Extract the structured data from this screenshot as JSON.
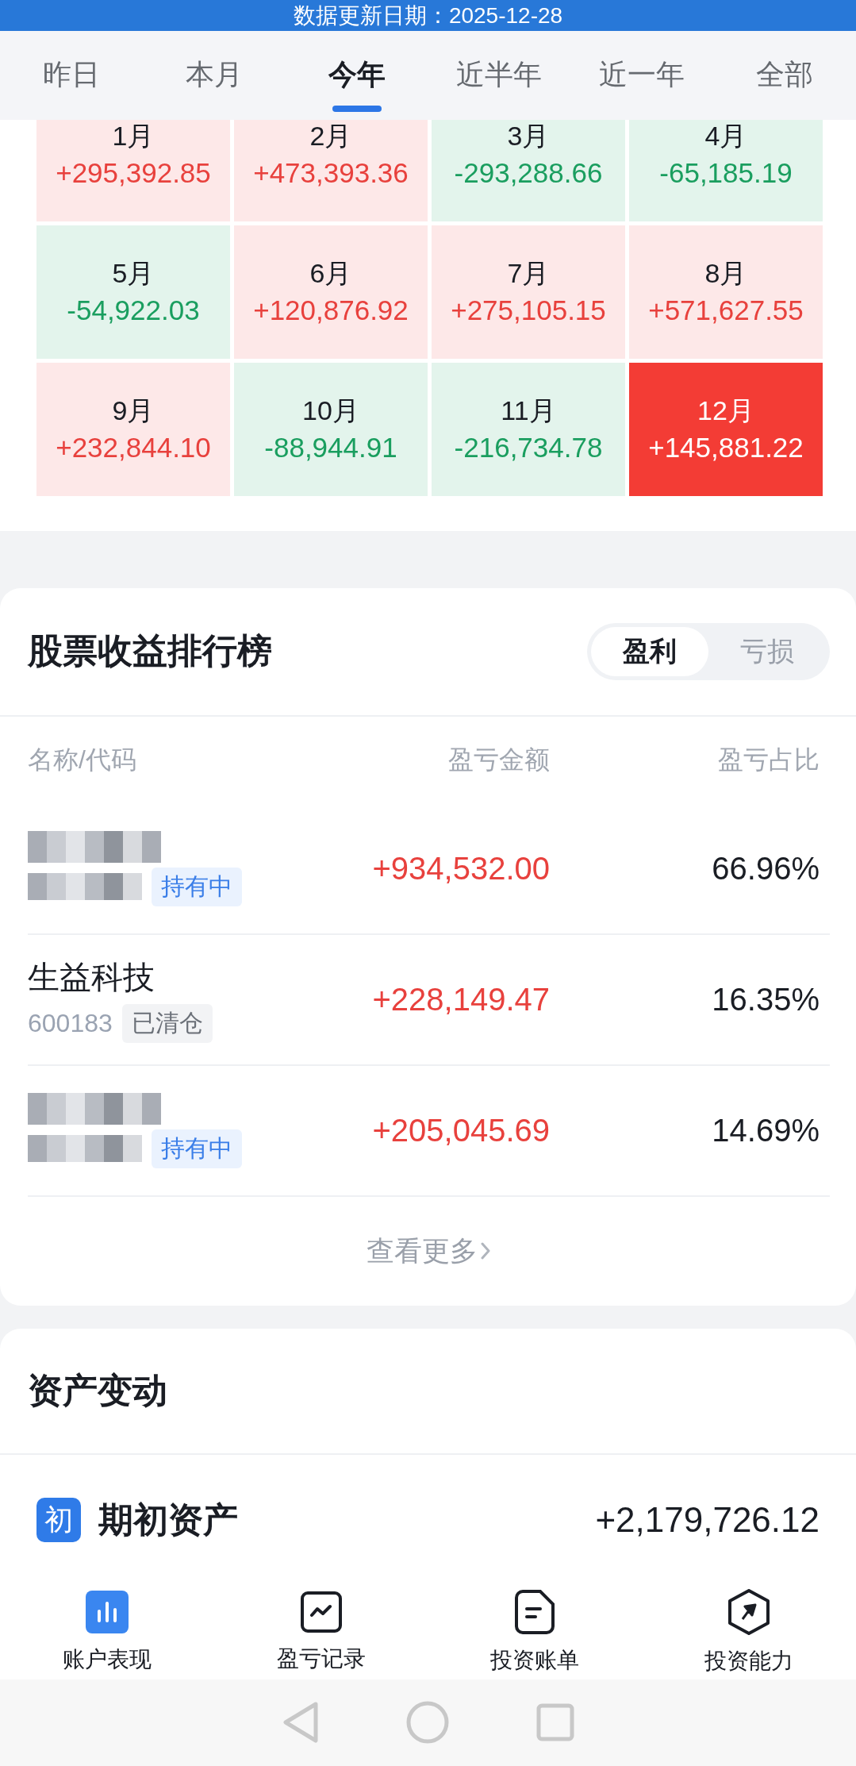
{
  "header": {
    "update_date": "数据更新日期：2025-12-28"
  },
  "tabs": [
    {
      "label": "昨日",
      "selected": false
    },
    {
      "label": "本月",
      "selected": false
    },
    {
      "label": "今年",
      "selected": true
    },
    {
      "label": "近半年",
      "selected": false
    },
    {
      "label": "近一年",
      "selected": false
    },
    {
      "label": "全部",
      "selected": false
    }
  ],
  "months": [
    {
      "label": "1月",
      "value": "+295,392.85",
      "kind": "up",
      "selected": false
    },
    {
      "label": "2月",
      "value": "+473,393.36",
      "kind": "up",
      "selected": false
    },
    {
      "label": "3月",
      "value": "-293,288.66",
      "kind": "down",
      "selected": false
    },
    {
      "label": "4月",
      "value": "-65,185.19",
      "kind": "down",
      "selected": false
    },
    {
      "label": "5月",
      "value": "-54,922.03",
      "kind": "down",
      "selected": false
    },
    {
      "label": "6月",
      "value": "+120,876.92",
      "kind": "up",
      "selected": false
    },
    {
      "label": "7月",
      "value": "+275,105.15",
      "kind": "up",
      "selected": false
    },
    {
      "label": "8月",
      "value": "+571,627.55",
      "kind": "up",
      "selected": false
    },
    {
      "label": "9月",
      "value": "+232,844.10",
      "kind": "up",
      "selected": false
    },
    {
      "label": "10月",
      "value": "-88,944.91",
      "kind": "down",
      "selected": false
    },
    {
      "label": "11月",
      "value": "-216,734.78",
      "kind": "down",
      "selected": false
    },
    {
      "label": "12月",
      "value": "+145,881.22",
      "kind": "up",
      "selected": true
    }
  ],
  "ranking": {
    "title": "股票收益排行榜",
    "toggle": [
      {
        "label": "盈利",
        "selected": true
      },
      {
        "label": "亏损",
        "selected": false
      }
    ],
    "columns": [
      "名称/代码",
      "盈亏金额",
      "盈亏占比"
    ],
    "rows": [
      {
        "redacted": true,
        "status": "持有中",
        "kind": "holding",
        "amount": "+934,532.00",
        "ratio": "66.96%"
      },
      {
        "redacted": false,
        "name": "生益科技",
        "code": "600183",
        "status": "已清仓",
        "kind": "closed",
        "amount": "+228,149.47",
        "ratio": "16.35%"
      },
      {
        "redacted": true,
        "status": "持有中",
        "kind": "holding",
        "amount": "+205,045.69",
        "ratio": "14.69%"
      }
    ],
    "more": "查看更多"
  },
  "assets": {
    "title": "资产变动",
    "rows": [
      {
        "badge": "初",
        "label": "期初资产",
        "value": "+2,179,726.12"
      }
    ]
  },
  "bottom_nav": [
    {
      "label": "账户表现",
      "kind": "bars",
      "selected": true
    },
    {
      "label": "盈亏记录",
      "kind": "trend",
      "selected": false
    },
    {
      "label": "投资账单",
      "kind": "bill",
      "selected": false
    },
    {
      "label": "投资能力",
      "kind": "compass",
      "selected": false
    }
  ]
}
